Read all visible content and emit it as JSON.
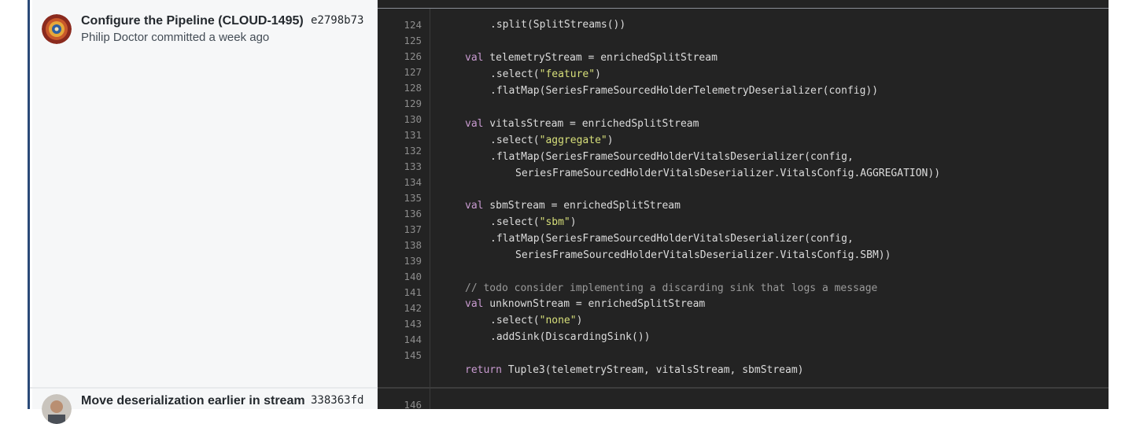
{
  "commits": [
    {
      "title": "Configure the Pipeline (CLOUD-1495)",
      "sha": "e2798b73",
      "meta": "Philip Doctor committed a week ago"
    },
    {
      "title": "Move deserialization earlier in stream",
      "sha": "338363fd"
    }
  ],
  "gutter": [
    "124",
    "125",
    "126",
    "127",
    "128",
    "129",
    "130",
    "131",
    "132",
    "133",
    "134",
    "135",
    "136",
    "137",
    "138",
    "139",
    "140",
    "141",
    "142",
    "143",
    "144",
    "145"
  ],
  "gutter_next": "146",
  "colors": {
    "code_bg": "#232323",
    "keyword": "#c99bd1",
    "string": "#d7df7a",
    "comment": "#9a9a9a",
    "accent_border": "#2a4a78"
  },
  "code": {
    "l0": ".split(SplitStreams())",
    "l2_kw": "val",
    "l2_rest": " telemetryStream = enrichedSplitStream",
    "l3_a": ".select(",
    "l3_s": "\"feature\"",
    "l3_b": ")",
    "l4": ".flatMap(SeriesFrameSourcedHolderTelemetryDeserializer(config))",
    "l6_kw": "val",
    "l6_rest": " vitalsStream = enrichedSplitStream",
    "l7_a": ".select(",
    "l7_s": "\"aggregate\"",
    "l7_b": ")",
    "l8": ".flatMap(SeriesFrameSourcedHolderVitalsDeserializer(config,",
    "l9": "SeriesFrameSourcedHolderVitalsDeserializer.VitalsConfig.AGGREGATION))",
    "l11_kw": "val",
    "l11_rest": " sbmStream = enrichedSplitStream",
    "l12_a": ".select(",
    "l12_s": "\"sbm\"",
    "l12_b": ")",
    "l13": ".flatMap(SeriesFrameSourcedHolderVitalsDeserializer(config,",
    "l14": "SeriesFrameSourcedHolderVitalsDeserializer.VitalsConfig.SBM))",
    "l16": "// todo consider implementing a discarding sink that logs a message",
    "l17_kw": "val",
    "l17_rest": " unknownStream = enrichedSplitStream",
    "l18_a": ".select(",
    "l18_s": "\"none\"",
    "l18_b": ")",
    "l19": ".addSink(DiscardingSink())",
    "l21_kw": "return",
    "l21_rest": " Tuple3(telemetryStream, vitalsStream, sbmStream)"
  }
}
